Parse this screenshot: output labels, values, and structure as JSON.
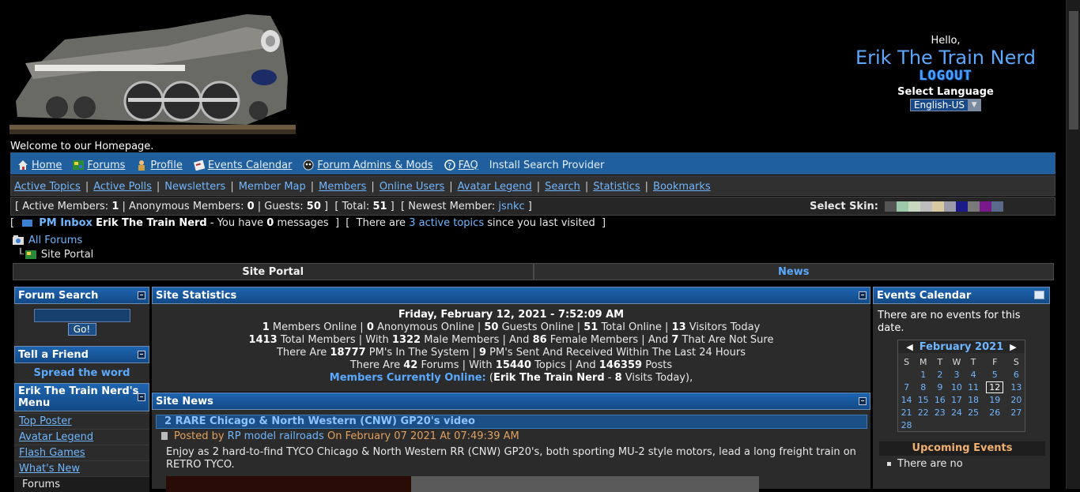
{
  "header": {
    "hello": "Hello,",
    "username": "Erik The Train Nerd",
    "logout": "LOGOUT",
    "select_language": "Select Language",
    "language_value": "English-US",
    "welcome": "Welcome to our Homepage."
  },
  "nav_main": [
    {
      "label": "Home",
      "icon": "home-icon"
    },
    {
      "label": "Forums",
      "icon": "forums-icon"
    },
    {
      "label": "Profile",
      "icon": "profile-icon"
    },
    {
      "label": "Events Calendar",
      "icon": "calendar-icon"
    },
    {
      "label": "Forum Admins & Mods",
      "icon": "admins-icon"
    },
    {
      "label": "FAQ",
      "icon": "help-icon"
    },
    {
      "label": "Install Search Provider",
      "icon": ""
    }
  ],
  "nav_secondary": [
    "Active Topics",
    "Active Polls",
    "Newsletters",
    "Member Map",
    "Members",
    "Online Users",
    "Avatar Legend",
    "Search",
    "Statistics",
    "Bookmarks"
  ],
  "stats_bar": {
    "active_members_label": "Active Members:",
    "active_members": "1",
    "anonymous_label": "Anonymous Members:",
    "anonymous": "0",
    "guests_label": "Guests:",
    "guests": "50",
    "total_label": "Total:",
    "total": "51",
    "newest_label": "Newest Member:",
    "newest": "jsnkc",
    "select_skin": "Select Skin:",
    "skin_colors": [
      "#555555",
      "#9cc9a9",
      "#c9d9c0",
      "#bdbdbd",
      "#d8c9a0",
      "#9a9aa8",
      "#1a1a8a",
      "#7a7a7a",
      "#7a1a8a",
      "#5a6a8a"
    ]
  },
  "pm": {
    "inbox_label": "PM Inbox",
    "user": "Erik The Train Nerd",
    "you_have": "- You have",
    "count": "0",
    "messages": "messages",
    "there_are": "There are",
    "active_topics": "3 active topics",
    "since": "since you last visited"
  },
  "breadcrumb": {
    "all_forums": "All Forums",
    "current": "Site Portal"
  },
  "tabs": {
    "portal": "Site Portal",
    "news": "News"
  },
  "left": {
    "forum_search": "Forum Search",
    "go": "Go!",
    "tell_friend": "Tell a Friend",
    "spread": "Spread the word",
    "menu_title": "Erik The Train Nerd's Menu",
    "menu_links": [
      "Top Poster",
      "Avatar Legend",
      "Flash Games",
      "What's New"
    ],
    "forums_item": "Forums"
  },
  "site_stats": {
    "title": "Site Statistics",
    "date": "Friday, February 12, 2021 - 7:52:09 AM",
    "members_online": "1",
    "anonymous_online": "0",
    "guests_online": "50",
    "total_online": "51",
    "visitors_today": "13",
    "total_members": "1413",
    "male": "1322",
    "female": "86",
    "not_sure": "7",
    "pms_total": "18777",
    "pms_24h": "9",
    "forums": "42",
    "topics": "15440",
    "posts": "146359",
    "currently_online_label": "Members Currently Online:",
    "currently_online_user": "Erik The Train Nerd",
    "currently_online_visits": "8"
  },
  "site_news": {
    "title": "Site News",
    "article_title": "2 RARE Chicago & North Western (CNW) GP20's video",
    "posted_by": "Posted by",
    "author": "RP model railroads",
    "posted_on": "On February 07 2021 At 07:49:39 AM",
    "body": "Enjoy as 2 hard-to-find TYCO Chicago & North Western RR (CNW) GP20's, both sporting MU-2 style motors, lead a long freight train on RETRO TYCO."
  },
  "events": {
    "title": "Events Calendar",
    "no_events": "There are no events for this date.",
    "month": "February 2021",
    "weekdays": [
      "S",
      "M",
      "T",
      "W",
      "T",
      "F",
      "S"
    ],
    "weeks": [
      [
        "",
        "1",
        "2",
        "3",
        "4",
        "5",
        "6"
      ],
      [
        "7",
        "8",
        "9",
        "10",
        "11",
        "12",
        "13"
      ],
      [
        "14",
        "15",
        "16",
        "17",
        "18",
        "19",
        "20"
      ],
      [
        "21",
        "22",
        "23",
        "24",
        "25",
        "26",
        "27"
      ],
      [
        "28",
        "",
        "",
        "",
        "",
        "",
        ""
      ]
    ],
    "today": "12",
    "upcoming": "Upcoming Events",
    "upcoming_text": "There are no"
  }
}
